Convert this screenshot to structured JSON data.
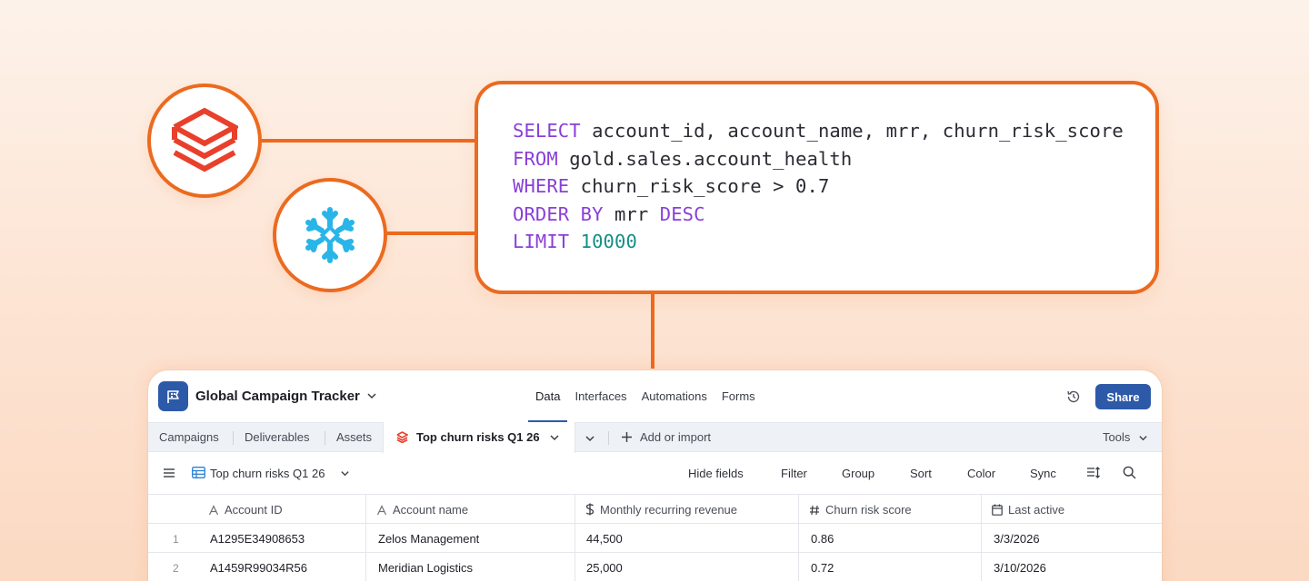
{
  "integrations": [
    {
      "name": "databricks-logo"
    },
    {
      "name": "snowflake-logo"
    }
  ],
  "query": {
    "lines": [
      [
        {
          "t": "SELECT",
          "k": "kw"
        },
        {
          "t": " account_id, account_name, mrr, churn_risk_score",
          "k": ""
        }
      ],
      [
        {
          "t": "FROM",
          "k": "kw"
        },
        {
          "t": " gold.sales.account_health",
          "k": ""
        }
      ],
      [
        {
          "t": "WHERE",
          "k": "kw"
        },
        {
          "t": " churn_risk_score > 0.7",
          "k": ""
        }
      ],
      [
        {
          "t": "ORDER BY",
          "k": "kw"
        },
        {
          "t": " mrr ",
          "k": ""
        },
        {
          "t": "DESC",
          "k": "kw"
        }
      ],
      [
        {
          "t": "LIMIT",
          "k": "kw"
        },
        {
          "t": " ",
          "k": ""
        },
        {
          "t": "10000",
          "k": "num"
        }
      ]
    ]
  },
  "app": {
    "title": "Global Campaign Tracker",
    "nav": [
      "Data",
      "Interfaces",
      "Automations",
      "Forms"
    ],
    "share_label": "Share",
    "tabs": [
      "Campaigns",
      "Deliverables",
      "Assets"
    ],
    "active_tab": "Top churn risks Q1 26",
    "add_import_label": "Add or import",
    "tools_label": "Tools",
    "view_name": "Top churn risks Q1 26",
    "view_actions": [
      "Hide fields",
      "Filter",
      "Group",
      "Sort",
      "Color",
      "Sync"
    ],
    "columns": [
      "Account ID",
      "Account name",
      "Monthly recurring revenue",
      "Churn risk score",
      "Last active"
    ],
    "rows": [
      {
        "num": "1",
        "cells": [
          "A1295E34908653",
          "Zelos Management",
          "44,500",
          "0.86",
          "3/3/2026"
        ]
      },
      {
        "num": "2",
        "cells": [
          "A1459R99034R56",
          "Meridian Logistics",
          "25,000",
          "0.72",
          "3/10/2026"
        ]
      }
    ]
  },
  "colors": {
    "accent": "#ec6a1f",
    "brand": "#2d5aa8",
    "keyword": "#8a3fd8",
    "number": "#148f86"
  }
}
